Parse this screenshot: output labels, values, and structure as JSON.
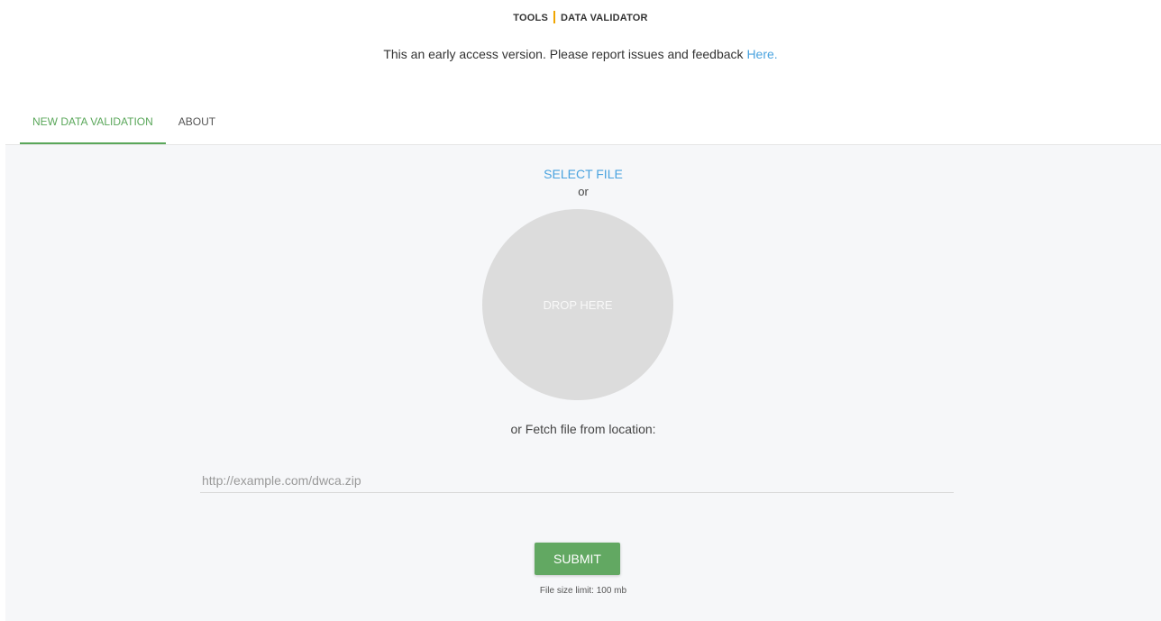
{
  "breadcrumb": {
    "tools": "TOOLS",
    "current": "DATA VALIDATOR",
    "separator_color": "#f0a500"
  },
  "notice": {
    "text": "This an early access version. Please report issues and feedback ",
    "link": "Here."
  },
  "tabs": [
    {
      "label": "NEW DATA VALIDATION",
      "active": true
    },
    {
      "label": "ABOUT",
      "active": false
    }
  ],
  "upload": {
    "select_file": "SELECT FILE",
    "or": "or",
    "drop_here": "DROP HERE",
    "fetch_label": "or Fetch file from location:",
    "url_placeholder": "http://example.com/dwca.zip",
    "url_value": ""
  },
  "submit": {
    "label": "SUBMIT",
    "size_limit": "File size limit: 100 mb"
  },
  "colors": {
    "accent_green": "#5aa75a",
    "link_blue": "#4aa3df",
    "background": "#f6f7f9"
  }
}
